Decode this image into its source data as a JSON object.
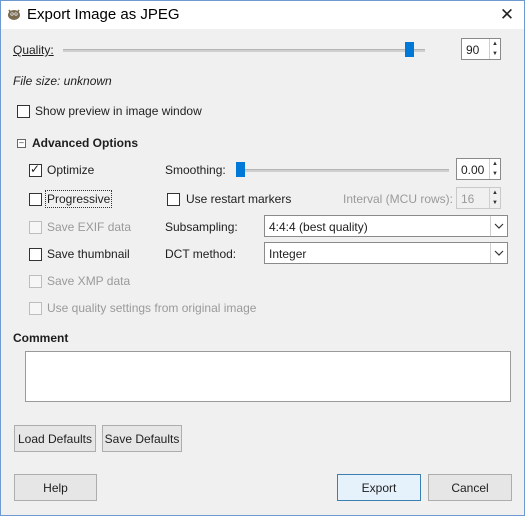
{
  "window": {
    "title": "Export Image as JPEG"
  },
  "icons": {
    "app": "gimp-icon",
    "close": "close-icon"
  },
  "quality": {
    "label": "Quality:",
    "value": "90",
    "slider_fraction": 0.92
  },
  "file_size": {
    "text": "File size: unknown"
  },
  "show_preview": {
    "label": "Show preview in image window",
    "checked": false
  },
  "advanced": {
    "header": "Advanced Options",
    "optimize": {
      "label": "Optimize",
      "checked": true
    },
    "smoothing": {
      "label": "Smoothing:",
      "value": "0.00",
      "slider_fraction": 0.0
    },
    "progressive": {
      "label": "Progressive",
      "checked": false
    },
    "restart_markers": {
      "label": "Use restart markers",
      "checked": false
    },
    "interval": {
      "label": "Interval (MCU rows):",
      "value": "16"
    },
    "save_exif": {
      "label": "Save EXIF data"
    },
    "subsampling": {
      "label": "Subsampling:",
      "value": "4:4:4 (best quality)"
    },
    "save_thumbnail": {
      "label": "Save thumbnail",
      "checked": false
    },
    "dct": {
      "label": "DCT method:",
      "value": "Integer"
    },
    "save_xmp": {
      "label": "Save XMP data"
    },
    "quality_original": {
      "label": "Use quality settings from original image"
    }
  },
  "comment": {
    "label": "Comment",
    "value": ""
  },
  "buttons": {
    "load_defaults": "Load Defaults",
    "save_defaults": "Save Defaults",
    "help": "Help",
    "export": "Export",
    "cancel": "Cancel"
  },
  "colors": {
    "accent": "#0078d7",
    "window_border": "#6d9bd1"
  }
}
